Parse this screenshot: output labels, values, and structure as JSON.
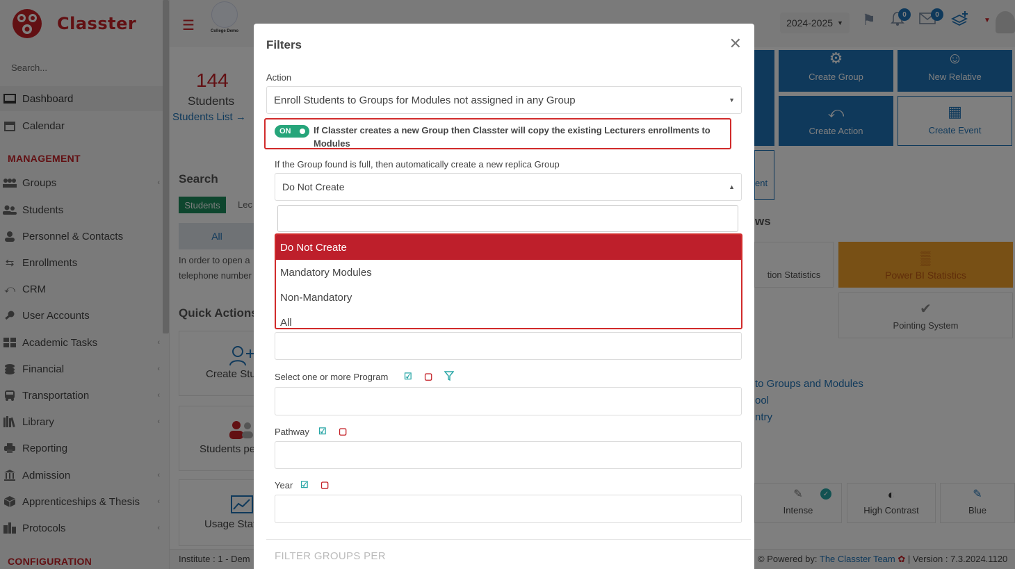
{
  "app": {
    "brand": "Classter",
    "search_placeholder": "Search...",
    "college": "College Demo",
    "year": "2024-2025"
  },
  "header": {
    "notifications_count": "0",
    "messages_count": "0"
  },
  "sidebar": {
    "items_top": [
      {
        "label": "Dashboard",
        "active": true
      },
      {
        "label": "Calendar"
      }
    ],
    "section_management": "MANAGEMENT",
    "items": [
      {
        "label": "Groups"
      },
      {
        "label": "Students"
      },
      {
        "label": "Personnel & Contacts"
      },
      {
        "label": "Enrollments"
      },
      {
        "label": "CRM"
      },
      {
        "label": "User Accounts"
      },
      {
        "label": "Academic Tasks"
      },
      {
        "label": "Financial"
      },
      {
        "label": "Transportation"
      },
      {
        "label": "Library"
      },
      {
        "label": "Reporting"
      },
      {
        "label": "Admission"
      },
      {
        "label": "Apprenticeships & Thesis"
      },
      {
        "label": "Protocols"
      }
    ],
    "section_configuration": "CONFIGURATION"
  },
  "dashboard": {
    "students_count": "144",
    "students_label": "Students",
    "students_list_link": "Students List",
    "search_heading": "Search",
    "tab_students": "Students",
    "tab_lecturers": "Lec",
    "all_label": "All",
    "search_note_1": "In order to open a",
    "search_note_2": "telephone number",
    "quick_actions": "Quick Actions",
    "qa_create_student": "Create Stu",
    "qa_students_per": "Students pe",
    "qa_usage_stats": "Usage Stat",
    "tiles": {
      "create_group": "Create Group",
      "new_relative": "New Relative",
      "create_action": "Create Action",
      "create_event": "Create Event",
      "ent_partial": "ent"
    },
    "views_partial": "ws",
    "stats_partial": "tion Statistics",
    "power_bi": "Power BI Statistics",
    "pointing_system": "Pointing System",
    "links": [
      "to Groups and Modules",
      "ool",
      "ntry"
    ],
    "themes": {
      "intense": "Intense",
      "high_contrast": "High Contrast",
      "blue": "Blue"
    },
    "institute": "Institute : 1 - Dem",
    "powered_by": "Powered by:",
    "powered_team": "The Classter Team",
    "version": "| Version : 7.3.2024.1120"
  },
  "modal": {
    "title": "Filters",
    "action_label": "Action",
    "action_value": "Enroll Students to Groups for Modules not assigned in any Group",
    "toggle_state": "ON",
    "toggle_text": "If Classter creates a new Group then Classter will copy the existing Lecturers enrollments to Modules",
    "replica_label": "If the Group found is full, then automatically create a new replica Group",
    "replica_value": "Do Not Create",
    "dropdown_options": [
      "Do Not Create",
      "Mandatory Modules",
      "Non-Mandatory",
      "All"
    ],
    "program_label": "Select one or more Program",
    "pathway_label": "Pathway",
    "year_label": "Year",
    "section_filter_groups": "FILTER GROUPS PER"
  }
}
